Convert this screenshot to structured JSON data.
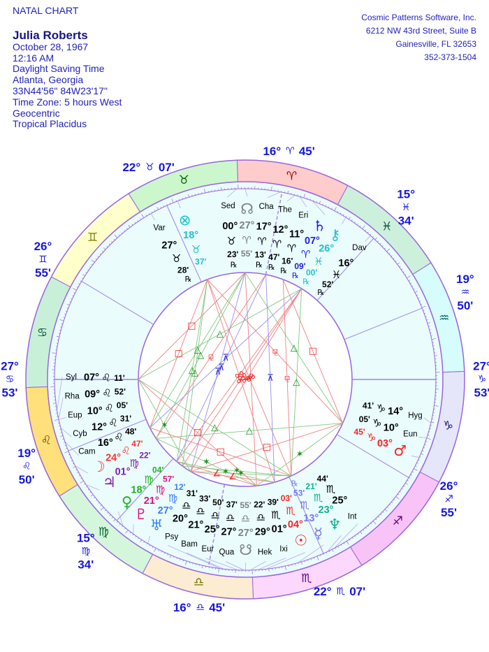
{
  "header": {
    "title": "NATAL CHART",
    "name": "Julia Roberts",
    "details": [
      "October 28, 1967",
      "12:16 AM",
      "Daylight Saving Time",
      "Atlanta, Georgia",
      "33N44'56\"  84W23'17\"",
      "Time Zone: 5 hours West",
      "Geocentric",
      "Tropical Placidus"
    ]
  },
  "publisher": [
    "Cosmic Patterns Software, Inc.",
    "6212 NW 43rd Street, Suite B",
    "Gainesville, FL 32653",
    "352-373-1504"
  ],
  "retro_symbol": "℞",
  "colors": {
    "ring_stroke": "#9966dd",
    "house_fill": "#eafcfc",
    "cusp_label": "#1515e0"
  },
  "signs": [
    {
      "glyph": "♈",
      "fill": "#ffcccc",
      "color": "#a00000"
    },
    {
      "glyph": "♉",
      "fill": "#ccf7cc",
      "color": "#006000"
    },
    {
      "glyph": "♊",
      "fill": "#ffffcc",
      "color": "#808000"
    },
    {
      "glyph": "♋",
      "fill": "#c8f0d8",
      "color": "#005030"
    },
    {
      "glyph": "♌",
      "fill": "#ffe07a",
      "color": "#804000"
    },
    {
      "glyph": "♍",
      "fill": "#d4f7dc",
      "color": "#006030"
    },
    {
      "glyph": "♎",
      "fill": "#fbecd2",
      "color": "#707000"
    },
    {
      "glyph": "♏",
      "fill": "#fcd8fc",
      "color": "#600080"
    },
    {
      "glyph": "♐",
      "fill": "#f8c4f8",
      "color": "#600080"
    },
    {
      "glyph": "♑",
      "fill": "#e6e6fa",
      "color": "#101070"
    },
    {
      "glyph": "♒",
      "fill": "#d6fcfc",
      "color": "#006060"
    },
    {
      "glyph": "♓",
      "fill": "#ccf0dc",
      "color": "#005040"
    }
  ],
  "cusps": [
    {
      "deg": "27°",
      "sign": "♋",
      "min": "53'"
    },
    {
      "deg": "19°",
      "sign": "♌",
      "min": "50'"
    },
    {
      "deg": "15°",
      "sign": "♍",
      "min": "34'"
    },
    {
      "deg": "16°",
      "sign": "♎",
      "min": "45'"
    },
    {
      "deg": "22°",
      "sign": "♏",
      "min": "07'"
    },
    {
      "deg": "26°",
      "sign": "♐",
      "min": "55'"
    },
    {
      "deg": "27°",
      "sign": "♑",
      "min": "53'"
    },
    {
      "deg": "19°",
      "sign": "♒",
      "min": "50'"
    },
    {
      "deg": "15°",
      "sign": "♓",
      "min": "34'"
    },
    {
      "deg": "16°",
      "sign": "♈",
      "min": "45'"
    },
    {
      "deg": "22°",
      "sign": "♉",
      "min": "07'"
    },
    {
      "deg": "26°",
      "sign": "♊",
      "min": "55'"
    }
  ],
  "bodies": [
    {
      "label": "Var",
      "deg": "27°",
      "sign": "♉",
      "min": "28'",
      "retro": true,
      "color": "#000000"
    },
    {
      "glyph": "⊗",
      "icon": "part-of-fortune-icon",
      "deg": "18°",
      "sign": "♉",
      "min": "37'",
      "retro": false,
      "color": "#20c0c8"
    },
    {
      "label": "Sed",
      "deg": "00°",
      "sign": "♉",
      "min": "23'",
      "retro": true,
      "color": "#000000"
    },
    {
      "glyph": "☊",
      "icon": "north-node-icon",
      "deg": "27°",
      "sign": "♈",
      "min": "55'",
      "retro": false,
      "color": "#808080"
    },
    {
      "label": "Cha",
      "deg": "17°",
      "sign": "♈",
      "min": "13'",
      "retro": true,
      "color": "#000000"
    },
    {
      "label": "The",
      "deg": "12°",
      "sign": "♈",
      "min": "47'",
      "retro": true,
      "color": "#000000"
    },
    {
      "label": "Eri",
      "deg": "11°",
      "sign": "♈",
      "min": "16'",
      "retro": true,
      "color": "#000000"
    },
    {
      "glyph": "♄",
      "icon": "saturn-icon",
      "deg": "07°",
      "sign": "♈",
      "min": "09'",
      "retro": true,
      "color": "#2020e0"
    },
    {
      "glyph": "⚷",
      "icon": "chiron-icon",
      "deg": "26°",
      "sign": "♓",
      "min": "00'",
      "retro": true,
      "color": "#20c0c8"
    },
    {
      "label": "Dav",
      "deg": "16°",
      "sign": "♓",
      "min": "52'",
      "retro": true,
      "color": "#000000"
    },
    {
      "label": "Hyg",
      "deg": "14°",
      "sign": "♑",
      "min": "41'",
      "retro": false,
      "color": "#000000"
    },
    {
      "label": "Eun",
      "deg": "10°",
      "sign": "♑",
      "min": "05'",
      "retro": false,
      "color": "#000000"
    },
    {
      "glyph": "♂",
      "icon": "mars-icon",
      "deg": "03°",
      "sign": "♑",
      "min": "45'",
      "retro": false,
      "color": "#ff2020"
    },
    {
      "label": "Int",
      "deg": "25°",
      "sign": "♏",
      "min": "44'",
      "retro": false,
      "color": "#000000"
    },
    {
      "glyph": "♆",
      "icon": "neptune-icon",
      "deg": "23°",
      "sign": "♏",
      "min": "21'",
      "retro": false,
      "color": "#10b090"
    },
    {
      "glyph": "☿",
      "icon": "mercury-icon",
      "deg": "13°",
      "sign": "♏",
      "min": "53'",
      "retro": true,
      "color": "#7878ee"
    },
    {
      "glyph": "☉",
      "icon": "sun-icon",
      "deg": "04°",
      "sign": "♏",
      "min": "03'",
      "retro": false,
      "color": "#ff2020"
    },
    {
      "label": "Ixi",
      "deg": "01°",
      "sign": "♏",
      "min": "39'",
      "retro": false,
      "color": "#000000"
    },
    {
      "label": "Hek",
      "deg": "29°",
      "sign": "♎",
      "min": "22'",
      "retro": false,
      "color": "#000000"
    },
    {
      "glyph": "☋",
      "icon": "south-node-icon",
      "deg": "27°",
      "sign": "♎",
      "min": "55'",
      "retro": false,
      "color": "#808080"
    },
    {
      "label": "Qua",
      "deg": "27°",
      "sign": "♎",
      "min": "37'",
      "retro": false,
      "color": "#000000"
    },
    {
      "label": "Eur",
      "deg": "25°",
      "sign": "♎",
      "min": "50'",
      "retro": false,
      "color": "#000000"
    },
    {
      "label": "Bam",
      "deg": "21°",
      "sign": "♎",
      "min": "33'",
      "retro": false,
      "color": "#000000"
    },
    {
      "label": "Psy",
      "deg": "20°",
      "sign": "♎",
      "min": "31'",
      "retro": false,
      "color": "#000000"
    },
    {
      "glyph": "♅",
      "icon": "uranus-icon",
      "deg": "27°",
      "sign": "♍",
      "min": "12'",
      "retro": false,
      "color": "#3a80f0"
    },
    {
      "glyph": "♇",
      "icon": "pluto-icon",
      "deg": "21°",
      "sign": "♍",
      "min": "57'",
      "retro": false,
      "color": "#e01080"
    },
    {
      "glyph": "♀",
      "icon": "venus-icon",
      "deg": "18°",
      "sign": "♍",
      "min": "04'",
      "retro": false,
      "color": "#20b020"
    },
    {
      "glyph": "♃",
      "icon": "jupiter-icon",
      "deg": "01°",
      "sign": "♍",
      "min": "22'",
      "retro": false,
      "color": "#8020b0"
    },
    {
      "glyph": "☽",
      "icon": "moon-icon",
      "deg": "24°",
      "sign": "♌",
      "min": "47'",
      "retro": false,
      "color": "#ff3030"
    },
    {
      "label": "Cam",
      "deg": "16°",
      "sign": "♌",
      "min": "48'",
      "retro": false,
      "color": "#000000"
    },
    {
      "label": "Cyb",
      "deg": "12°",
      "sign": "♌",
      "min": "31'",
      "retro": false,
      "color": "#000000"
    },
    {
      "label": "Eup",
      "deg": "10°",
      "sign": "♌",
      "min": "05'",
      "retro": false,
      "color": "#000000"
    },
    {
      "label": "Rha",
      "deg": "09°",
      "sign": "♌",
      "min": "52'",
      "retro": false,
      "color": "#000000"
    },
    {
      "label": "Syl",
      "deg": "07°",
      "sign": "♌",
      "min": "11'",
      "retro": false,
      "color": "#000000"
    }
  ],
  "aspect_types": [
    {
      "angle": 180,
      "orb": 8,
      "glyph": "☍",
      "color": "#ee2020",
      "line": "#f08080"
    },
    {
      "angle": 90,
      "orb": 7,
      "glyph": "□",
      "color": "#ee2020",
      "line": "#f08080"
    },
    {
      "angle": 120,
      "orb": 7,
      "glyph": "△",
      "color": "#109010",
      "line": "#80c880"
    },
    {
      "angle": 60,
      "orb": 5,
      "glyph": "✶",
      "color": "#109010",
      "line": "#80c880"
    },
    {
      "angle": 150,
      "orb": 3,
      "glyph": "⊼",
      "color": "#2020e0",
      "line": "#9090f0"
    },
    {
      "angle": 45,
      "orb": 2,
      "glyph": "∠",
      "color": "#ee2020",
      "line": "#f08080"
    },
    {
      "angle": 135,
      "orb": 2,
      "glyph": "⚼",
      "color": "#ee2020",
      "line": "#f08080"
    },
    {
      "angle": 30,
      "orb": 1.5,
      "glyph": "⊻",
      "color": "#109010",
      "line": "#80c880"
    }
  ]
}
